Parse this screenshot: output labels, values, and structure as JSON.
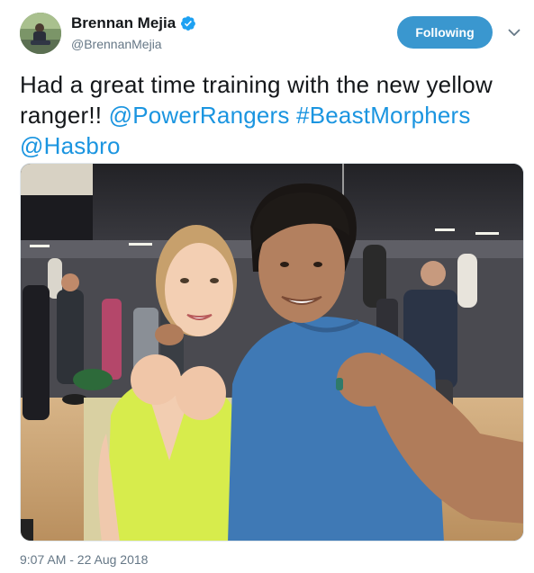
{
  "tweet": {
    "author": {
      "display_name": "Brennan Mejia",
      "handle": "@BrennanMejia",
      "verified": true
    },
    "follow_button_label": "Following",
    "text_parts": [
      {
        "type": "text",
        "value": "Had a great time training with the new yellow ranger!! "
      },
      {
        "type": "mention",
        "value": "@PowerRangers"
      },
      {
        "type": "text",
        "value": " "
      },
      {
        "type": "hashtag",
        "value": "#BeastMorphers"
      },
      {
        "type": "text",
        "value": " "
      },
      {
        "type": "mention",
        "value": "@Hasbro"
      }
    ],
    "timestamp": "9:07 AM - 22 Aug 2018"
  },
  "colors": {
    "link": "#1b95e0",
    "follow_button": "#3a97cf",
    "secondary_text": "#657786"
  },
  "icons": {
    "verified": "verified-badge-icon",
    "more": "chevron-down-icon"
  }
}
